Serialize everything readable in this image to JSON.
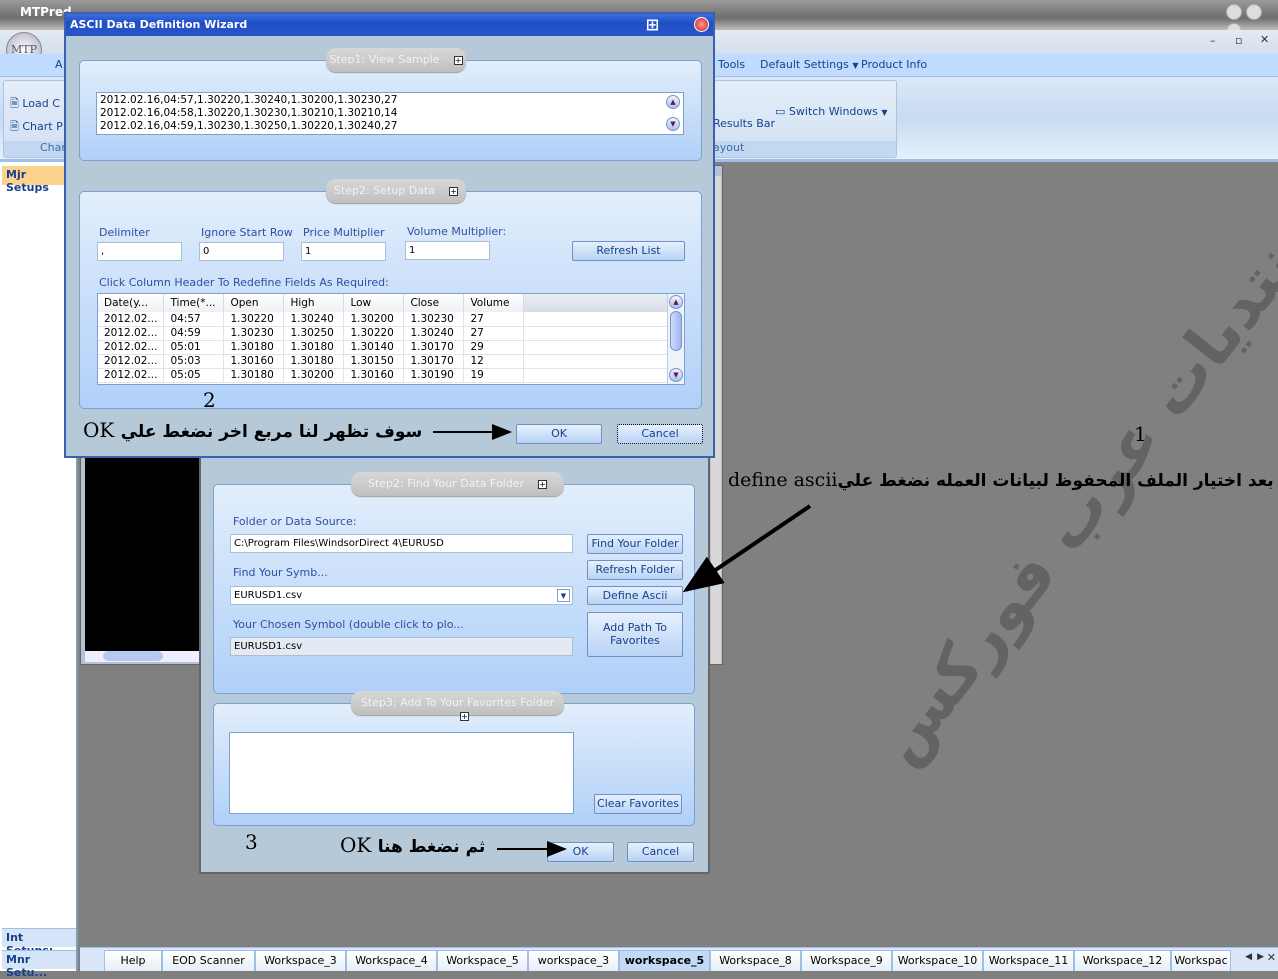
{
  "app": {
    "title": "MTPred",
    "window_controls": [
      "minimize-icon",
      "restore-icon",
      "close-icon"
    ]
  },
  "menu": {
    "items": [
      {
        "label": "Tools"
      },
      {
        "label": "Default Settings"
      },
      {
        "label": "Product Info"
      }
    ]
  },
  "ribbon": {
    "load": "Load C",
    "chart": "Chart P",
    "group_left": "Chart",
    "results_bar": "Results Bar",
    "switch_windows": "Switch Windows",
    "group_right": "ayout",
    "small_label": "A"
  },
  "sidebar": {
    "top": "Mjr Setups",
    "int": "Int Setups:",
    "mnr": "Mnr Setu..."
  },
  "wizard": {
    "title": "ASCII Data Definition Wizard",
    "step1": {
      "title": "Step1: View Sample",
      "lines": [
        "2012.02.16,04:57,1.30220,1.30240,1.30200,1.30230,27",
        "2012.02.16,04:58,1.30220,1.30230,1.30210,1.30210,14",
        "2012.02.16,04:59,1.30230,1.30250,1.30220,1.30240,27"
      ]
    },
    "step2": {
      "title": "Step2: Setup Data",
      "delimiter_label": "Delimiter",
      "delimiter": ",",
      "ignore_label": "Ignore Start Row",
      "ignore": "0",
      "price_label": "Price Multiplier",
      "price": "1",
      "volume_label": "Volume Multiplier:",
      "volume": "1",
      "refresh": "Refresh List",
      "hint": "Click Column Header To Redefine Fields As Required:",
      "columns": [
        "Date(y...",
        "Time(*...",
        "Open",
        "High",
        "Low",
        "Close",
        "Volume"
      ],
      "rows": [
        [
          "2012.02...",
          "04:57",
          "1.30220",
          "1.30240",
          "1.30200",
          "1.30230",
          "27"
        ],
        [
          "2012.02...",
          "04:59",
          "1.30230",
          "1.30250",
          "1.30220",
          "1.30240",
          "27"
        ],
        [
          "2012.02...",
          "05:01",
          "1.30180",
          "1.30180",
          "1.30140",
          "1.30170",
          "29"
        ],
        [
          "2012.02...",
          "05:03",
          "1.30160",
          "1.30180",
          "1.30150",
          "1.30170",
          "12"
        ],
        [
          "2012.02...",
          "05:05",
          "1.30180",
          "1.30200",
          "1.30160",
          "1.30190",
          "19"
        ]
      ]
    },
    "ok": "OK",
    "cancel": "Cancel"
  },
  "folder_dialog": {
    "step2_title": "Step2: Find Your Data Folder",
    "folder_label": "Folder or Data Source:",
    "folder": "C:\\Program Files\\WindsorDirect 4\\EURUSD",
    "find_folder": "Find Your Folder",
    "symbol_label": "Find Your Symb...",
    "symbol": "EURUSD1.csv",
    "refresh_folder": "Refresh Folder",
    "define_ascii": "Define Ascii",
    "chosen_label": "Your Chosen Symbol (double click to plo...",
    "chosen": "EURUSD1.csv",
    "add_path": "Add Path To Favorites",
    "step3_title": "Step3: Add To Your Favorites Folder",
    "clear_favorites": "Clear Favorites",
    "ok": "OK",
    "cancel": "Cancel"
  },
  "tabs": [
    {
      "label": "Help"
    },
    {
      "label": "EOD Scanner"
    },
    {
      "label": "Workspace_3"
    },
    {
      "label": "Workspace_4"
    },
    {
      "label": "Workspace_5"
    },
    {
      "label": "workspace_3"
    },
    {
      "label": "workspace_5",
      "active": true
    },
    {
      "label": "Workspace_8"
    },
    {
      "label": "Workspace_9"
    },
    {
      "label": "Workspace_10"
    },
    {
      "label": "Workspace_11"
    },
    {
      "label": "Workspace_12"
    },
    {
      "label": "Workspac"
    }
  ],
  "annotations": {
    "n1": "1",
    "n2": "2",
    "n3": "3",
    "text1": "بعد اختيار الملف المحفوظ لبيانات العمله نضغط علي",
    "text1_en": "define ascii",
    "text2": "سوف تظهر لنا مربع اخر نضغط علي",
    "text2_en": "OK",
    "text3": "ثم نضغط هنا",
    "text3_en": "OK"
  },
  "watermark": "منتديات عرب فوركس",
  "colors": {
    "workspace": "#808080",
    "title_blue": "#2a55c9",
    "label_blue": "#2f4fa0"
  }
}
